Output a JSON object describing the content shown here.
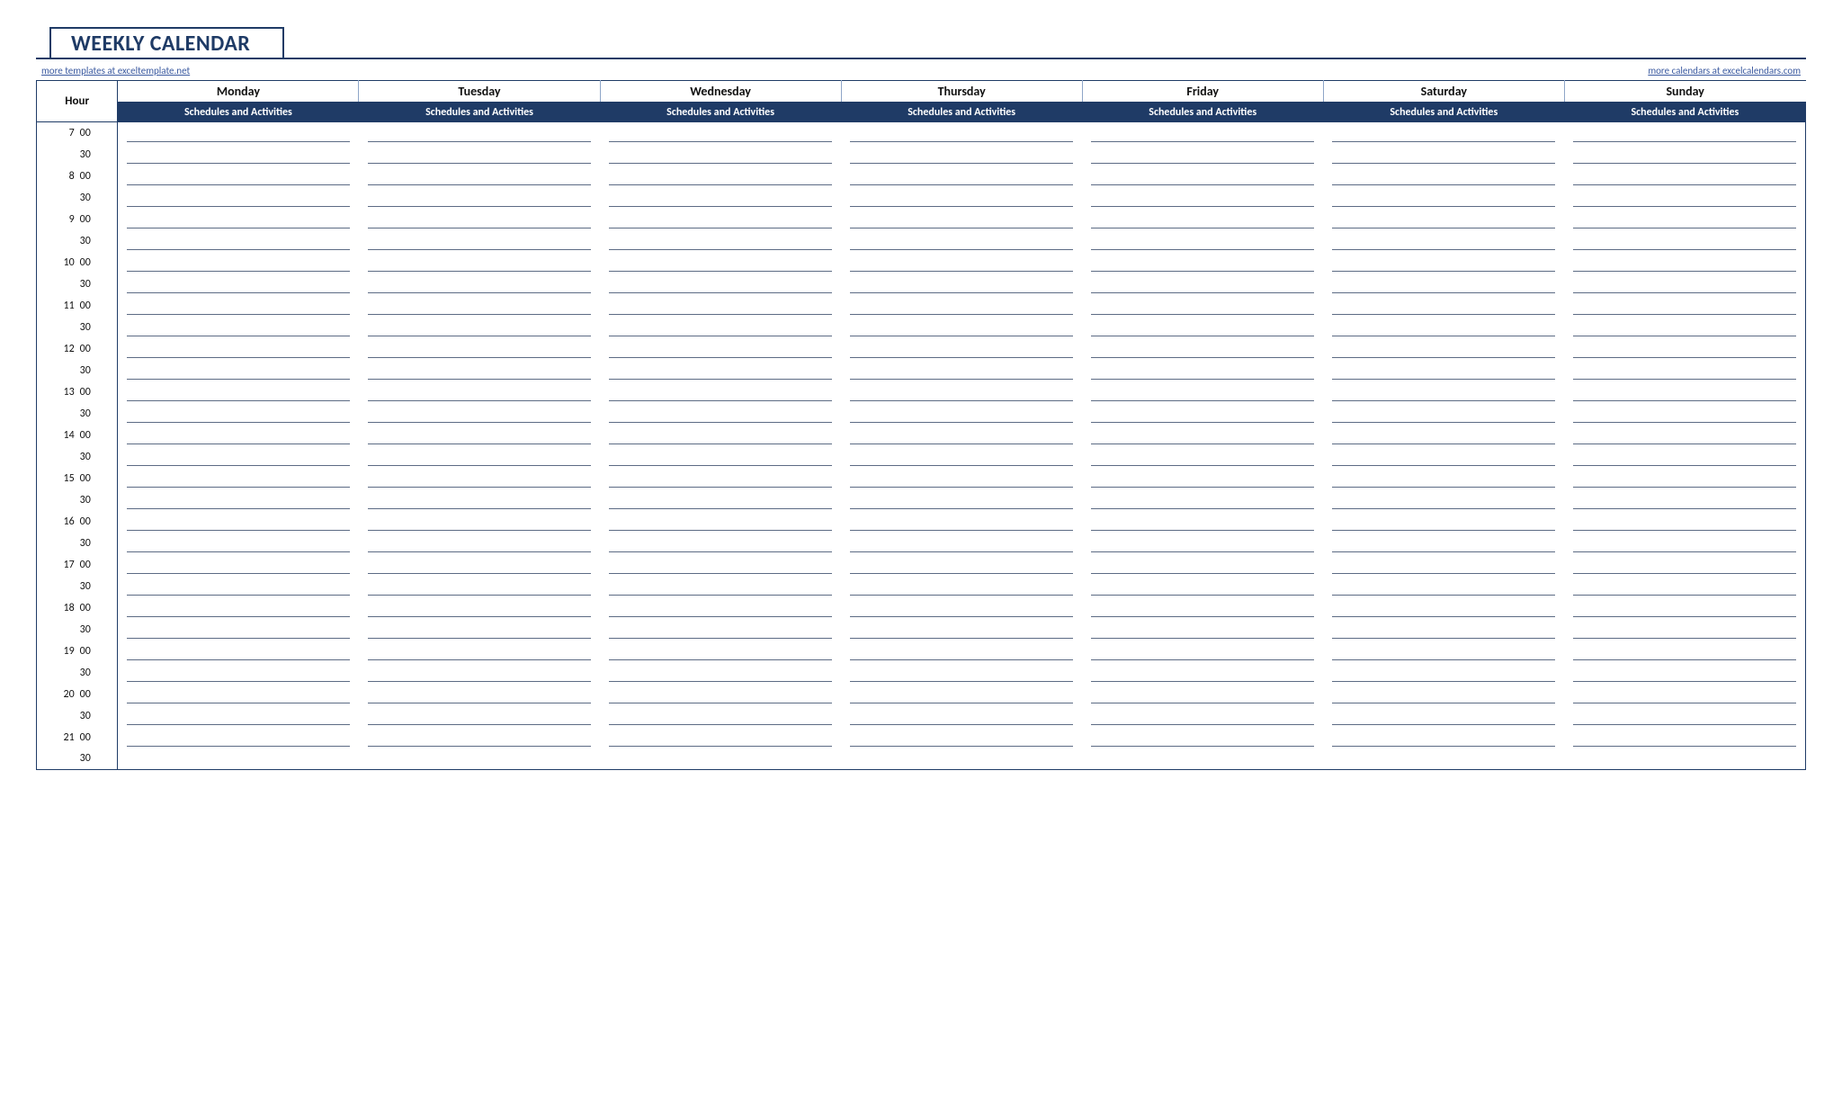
{
  "title": "WEEKLY CALENDAR",
  "links": {
    "left": "more templates at exceltemplate.net",
    "right": "more calendars at excelcalendars.com"
  },
  "headers": {
    "hour": "Hour",
    "subheader": "Schedules and Activities",
    "days": [
      "Monday",
      "Tuesday",
      "Wednesday",
      "Thursday",
      "Friday",
      "Saturday",
      "Sunday"
    ]
  },
  "rows": [
    {
      "hour": "7",
      "minute": "00"
    },
    {
      "hour": "",
      "minute": "30"
    },
    {
      "hour": "8",
      "minute": "00"
    },
    {
      "hour": "",
      "minute": "30"
    },
    {
      "hour": "9",
      "minute": "00"
    },
    {
      "hour": "",
      "minute": "30"
    },
    {
      "hour": "10",
      "minute": "00"
    },
    {
      "hour": "",
      "minute": "30"
    },
    {
      "hour": "11",
      "minute": "00"
    },
    {
      "hour": "",
      "minute": "30"
    },
    {
      "hour": "12",
      "minute": "00"
    },
    {
      "hour": "",
      "minute": "30"
    },
    {
      "hour": "13",
      "minute": "00"
    },
    {
      "hour": "",
      "minute": "30"
    },
    {
      "hour": "14",
      "minute": "00"
    },
    {
      "hour": "",
      "minute": "30"
    },
    {
      "hour": "15",
      "minute": "00"
    },
    {
      "hour": "",
      "minute": "30"
    },
    {
      "hour": "16",
      "minute": "00"
    },
    {
      "hour": "",
      "minute": "30"
    },
    {
      "hour": "17",
      "minute": "00"
    },
    {
      "hour": "",
      "minute": "30"
    },
    {
      "hour": "18",
      "minute": "00"
    },
    {
      "hour": "",
      "minute": "30"
    },
    {
      "hour": "19",
      "minute": "00"
    },
    {
      "hour": "",
      "minute": "30"
    },
    {
      "hour": "20",
      "minute": "00"
    },
    {
      "hour": "",
      "minute": "30"
    },
    {
      "hour": "21",
      "minute": "00"
    },
    {
      "hour": "",
      "minute": "30"
    }
  ],
  "colors": {
    "brand": "#1f3b66",
    "line": "#5c6b84"
  }
}
